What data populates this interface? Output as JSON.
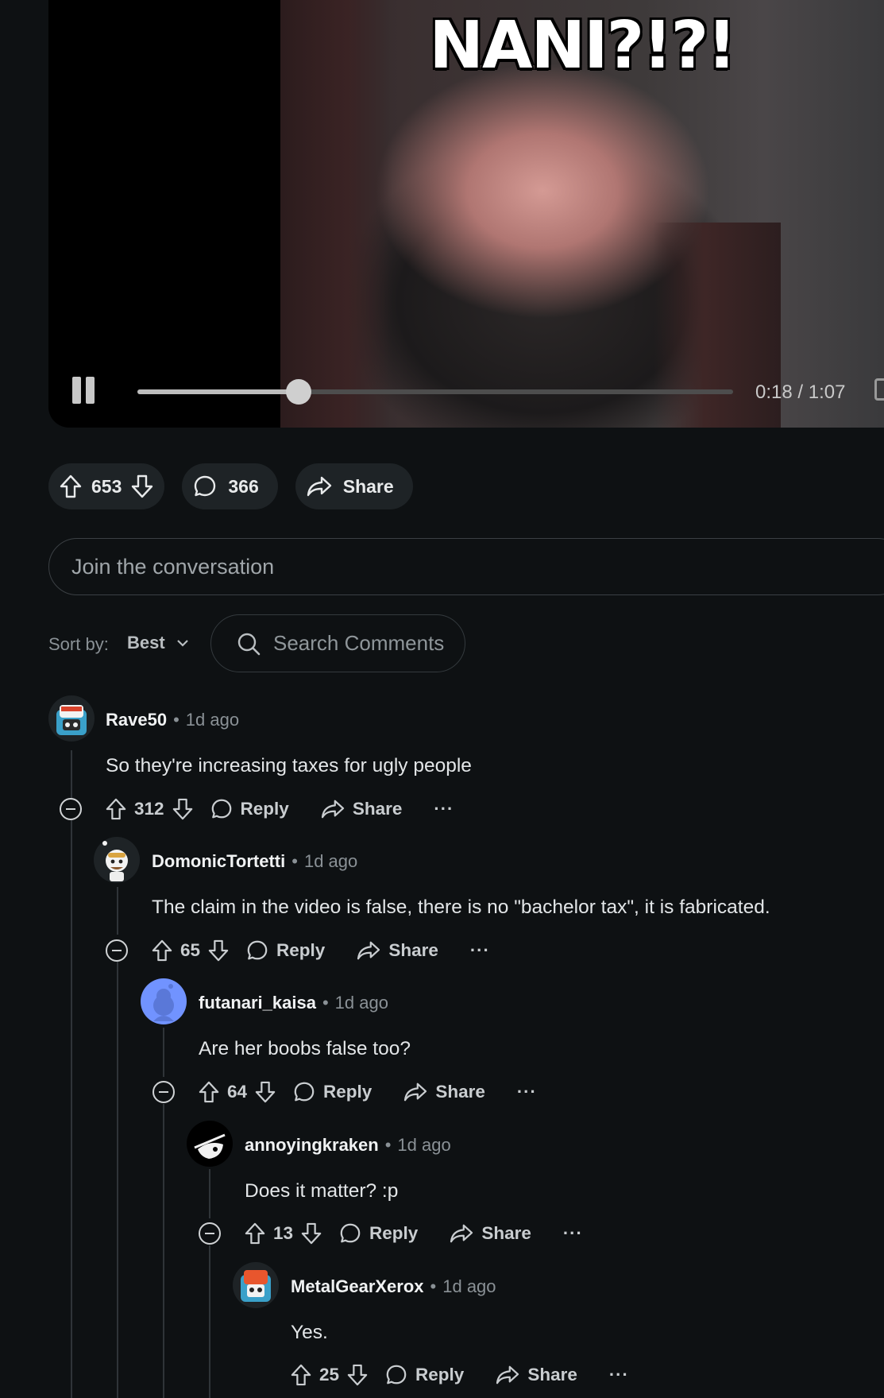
{
  "video": {
    "caption": "NANI?!?!",
    "timecode": "0:18 / 1:07",
    "progress_fraction": 0.27
  },
  "post_actions": {
    "upvotes": "653",
    "comments": "366",
    "share_label": "Share"
  },
  "join": {
    "placeholder": "Join the conversation"
  },
  "sort": {
    "label": "Sort by:",
    "value": "Best"
  },
  "search": {
    "placeholder": "Search Comments"
  },
  "comments": [
    {
      "user": "Rave50",
      "time": "1d ago",
      "body": "So they're increasing taxes for ugly people",
      "votes": "312",
      "reply": "Reply",
      "share": "Share",
      "more": "···"
    },
    {
      "user": "DomonicTortetti",
      "time": "1d ago",
      "body": "The claim in the video is false, there is no \"bachelor tax\", it is fabricated.",
      "votes": "65",
      "reply": "Reply",
      "share": "Share",
      "more": "···"
    },
    {
      "user": "futanari_kaisa",
      "time": "1d ago",
      "body": "Are her boobs false too?",
      "votes": "64",
      "reply": "Reply",
      "share": "Share",
      "more": "···"
    },
    {
      "user": "annoyingkraken",
      "time": "1d ago",
      "body": "Does it matter? :p",
      "votes": "13",
      "reply": "Reply",
      "share": "Share",
      "more": "···"
    },
    {
      "user": "MetalGearXerox",
      "time": "1d ago",
      "body": "Yes.",
      "votes": "25",
      "reply": "Reply",
      "share": "Share",
      "more": "···"
    }
  ],
  "meta_dot": "•"
}
